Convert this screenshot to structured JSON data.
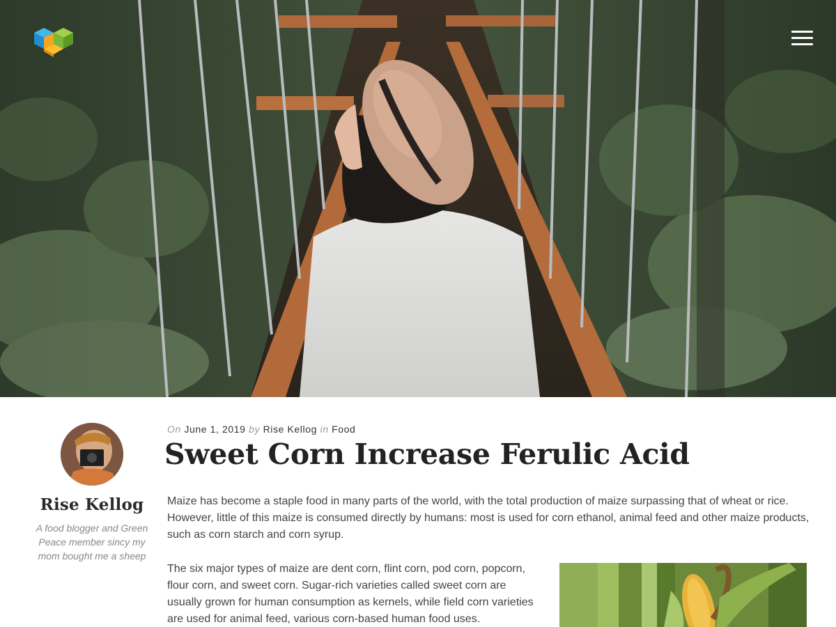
{
  "header": {
    "logo": "cube-logo",
    "menu_icon": "hamburger-menu-icon"
  },
  "hero": {
    "image": "woman-in-hat-on-suspension-bridge"
  },
  "author": {
    "name": "Rise Kellog",
    "bio": "A food blogger and Green Peace member sincy my mom bought me a sheep"
  },
  "post": {
    "meta": {
      "on_label": "On",
      "date": "June 1, 2019",
      "by_label": "by",
      "author": "Rise Kellog",
      "in_label": "in",
      "category": "Food"
    },
    "title": "Sweet Corn Increase Ferulic Acid",
    "paragraphs": [
      "Maize has become a staple food in many parts of the world, with the total production of maize surpassing that of wheat or rice. However, little of this maize is consumed directly by humans: most is used for corn ethanol, animal feed and other maize products, such as corn starch and corn syrup.",
      "The six major types of maize are dent corn, flint corn, pod corn, popcorn, flour corn, and sweet corn. Sugar-rich varieties called sweet corn are usually grown for human consumption as kernels, while field corn varieties are used for animal feed, various corn-based human food uses."
    ],
    "inline_image": "corn-cob-on-stalk"
  },
  "colors": {
    "title": "#222222",
    "meta_label": "#9a9a9a",
    "body_text": "#444444",
    "bio_text": "#888888"
  }
}
